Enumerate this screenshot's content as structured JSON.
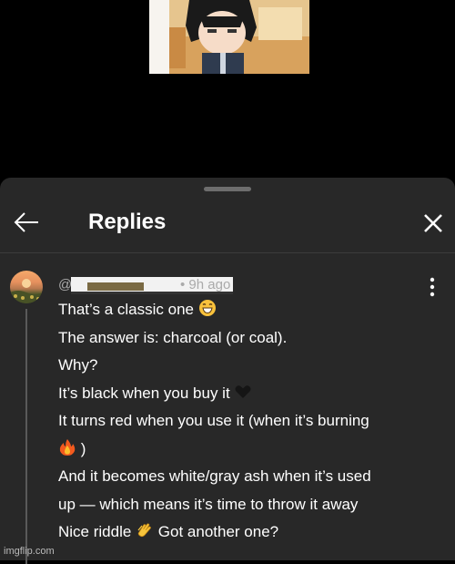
{
  "video": {
    "thumbnail_icon": "anime-character-thumbnail"
  },
  "sheet": {
    "title": "Replies",
    "back_icon": "arrow-left-icon",
    "close_icon": "close-icon"
  },
  "comment": {
    "handle_prefix": "@",
    "timestamp": "• 9h ago",
    "lines": [
      "That’s a classic one",
      "The answer is: charcoal (or coal).",
      "Why?",
      "It’s black when you buy it",
      "It turns red when you use it (when it’s burning",
      ")",
      "And it becomes white/gray ash when it’s used",
      "up — which means it’s time to throw it away",
      "Nice riddle",
      "Got another one?"
    ]
  },
  "watermark": "imgflip.com",
  "colors": {
    "sheet_bg": "#282828",
    "page_bg": "#000000",
    "text": "#ffffff",
    "meta": "#aaaaaa"
  }
}
